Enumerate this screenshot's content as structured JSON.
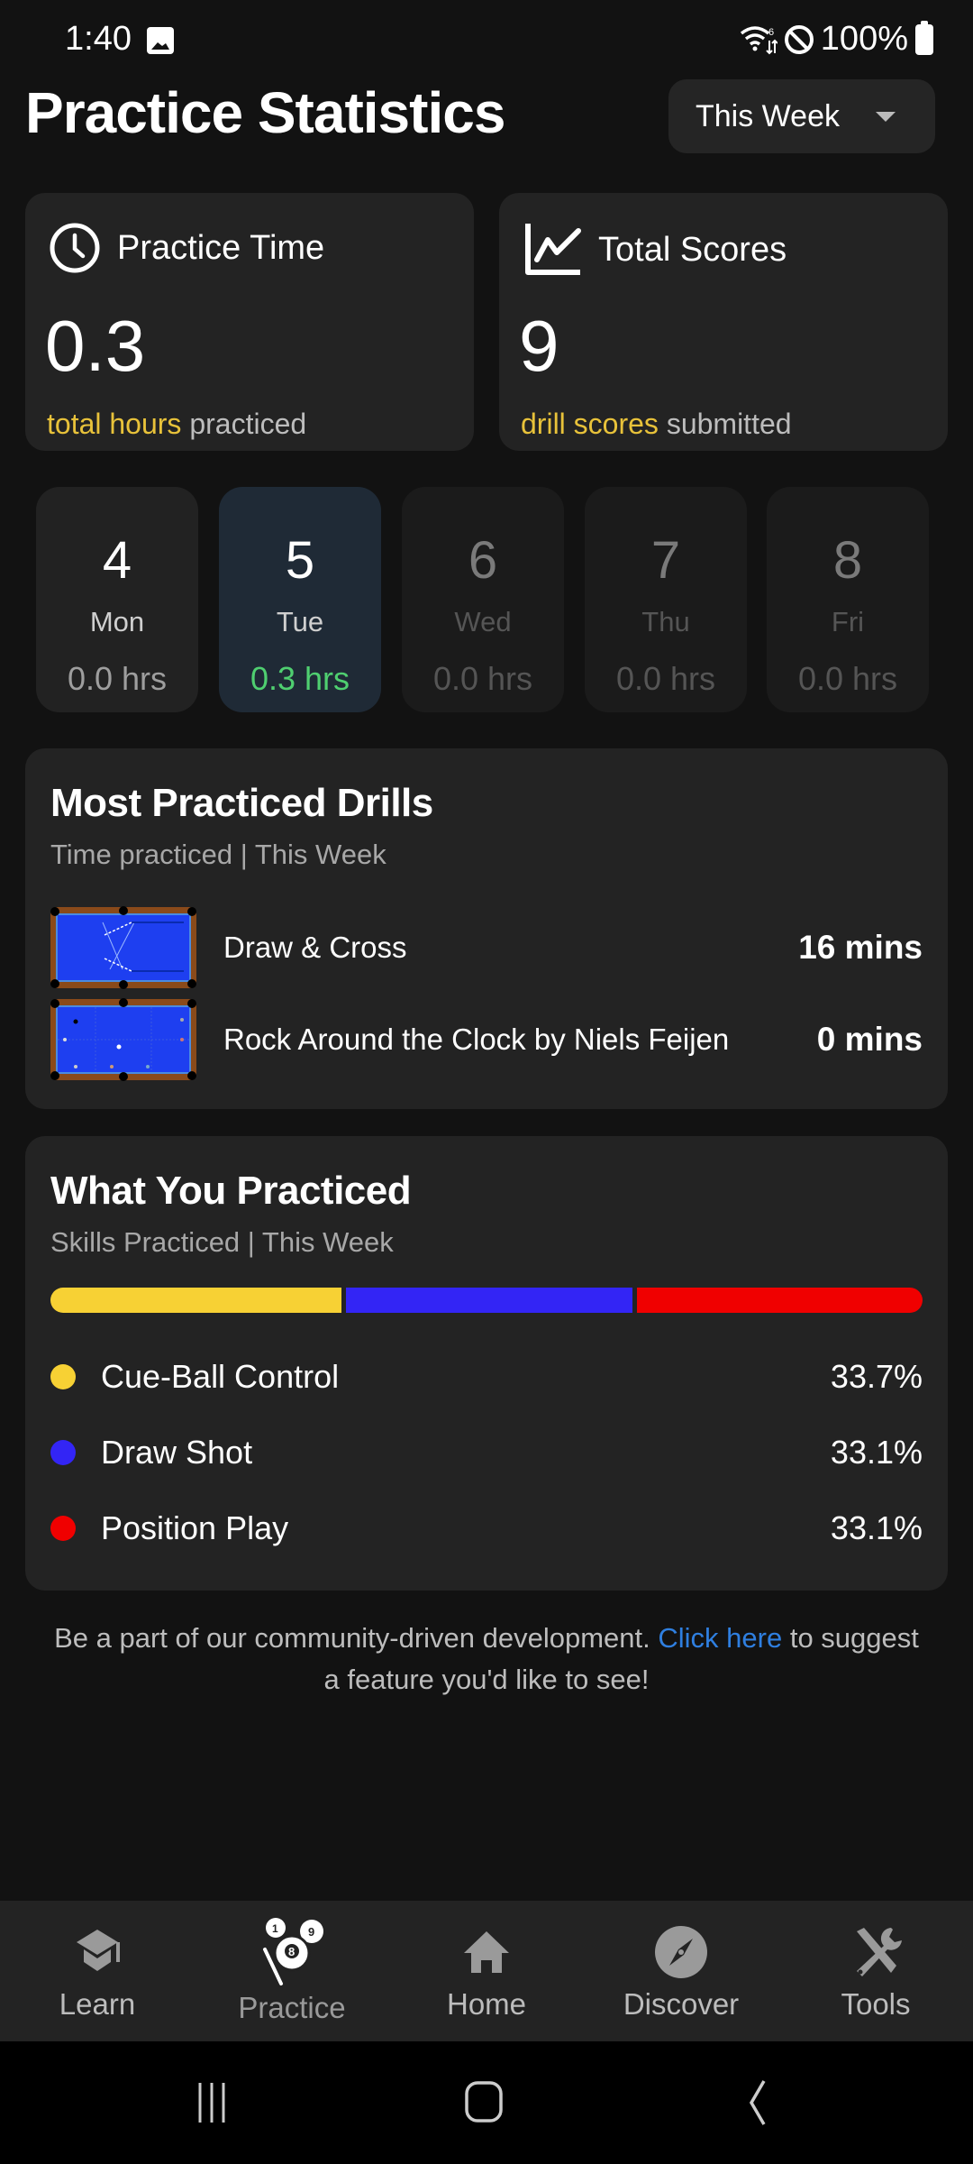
{
  "status_bar": {
    "time": "1:40",
    "battery": "100%",
    "icons": [
      "gallery-icon",
      "wifi-icon",
      "do-not-disturb-icon",
      "battery-icon"
    ]
  },
  "header": {
    "title": "Practice Statistics",
    "period_select": {
      "value": "This Week",
      "icon": "dropdown-caret-icon"
    }
  },
  "summary": {
    "practice_time": {
      "label": "Practice Time",
      "icon": "clock-icon",
      "value": "0.3",
      "foot_highlight": "total hours",
      "foot_rest": " practiced"
    },
    "total_scores": {
      "label": "Total Scores",
      "icon": "line-chart-icon",
      "value": "9",
      "foot_highlight": "drill scores",
      "foot_rest": " submitted"
    }
  },
  "days": [
    {
      "num": "4",
      "name": "Mon",
      "hours": "0.0 hrs",
      "state": "past"
    },
    {
      "num": "5",
      "name": "Tue",
      "hours": "0.3 hrs",
      "state": "active"
    },
    {
      "num": "6",
      "name": "Wed",
      "hours": "0.0 hrs",
      "state": "future"
    },
    {
      "num": "7",
      "name": "Thu",
      "hours": "0.0 hrs",
      "state": "future"
    },
    {
      "num": "8",
      "name": "Fri",
      "hours": "0.0 hrs",
      "state": "future"
    }
  ],
  "drills": {
    "title": "Most Practiced Drills",
    "subtitle": "Time practiced | This Week",
    "items": [
      {
        "name": "Draw & Cross",
        "time": "16 mins",
        "thumb": "pool-table-diagram"
      },
      {
        "name": "Rock Around the Clock by Niels Feijen",
        "time": "0 mins",
        "thumb": "pool-table-diagram"
      }
    ]
  },
  "skills": {
    "title": "What You Practiced",
    "subtitle": "Skills Practiced | This Week",
    "items": [
      {
        "name": "Cue-Ball Control",
        "percent_label": "33.7%",
        "percent": 33.7,
        "color": "#f7d134"
      },
      {
        "name": "Draw Shot",
        "percent_label": "33.1%",
        "percent": 33.1,
        "color": "#3325f5"
      },
      {
        "name": "Position Play",
        "percent_label": "33.1%",
        "percent": 33.1,
        "color": "#f00000"
      }
    ]
  },
  "feedback": {
    "before": "Be a part of our community-driven development. ",
    "link": "Click here",
    "after": " to suggest a feature you'd like to see!"
  },
  "bottom_nav": {
    "items": [
      {
        "label": "Learn",
        "icon": "graduation-cap-icon",
        "active": false
      },
      {
        "label": "Practice",
        "icon": "billiard-balls-icon",
        "active": true
      },
      {
        "label": "Home",
        "icon": "home-icon",
        "active": false
      },
      {
        "label": "Discover",
        "icon": "compass-icon",
        "active": false
      },
      {
        "label": "Tools",
        "icon": "tools-icon",
        "active": false
      }
    ]
  },
  "system_nav": {
    "buttons": [
      "recents-icon",
      "home-circle-icon",
      "back-icon"
    ]
  },
  "colors": {
    "accent_yellow": "#e8c23a",
    "active_green": "#4fcf70",
    "link_blue": "#2f7fe0",
    "card_bg": "#232323",
    "page_bg": "#121212"
  }
}
